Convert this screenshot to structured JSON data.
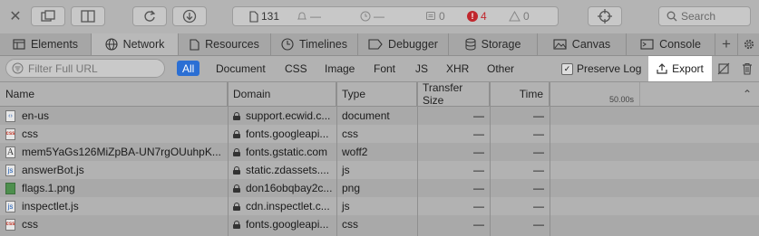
{
  "toolbar": {
    "resource_count": "131",
    "warnings_count_a": "—",
    "timer_value": "—",
    "logs_count": "0",
    "errors_count": "4",
    "issues_count": "0",
    "search_label": "Search"
  },
  "tabs": [
    "Elements",
    "Network",
    "Resources",
    "Timelines",
    "Debugger",
    "Storage",
    "Canvas",
    "Console"
  ],
  "filter": {
    "placeholder": "Filter Full URL",
    "types": [
      "All",
      "Document",
      "CSS",
      "Image",
      "Font",
      "JS",
      "XHR",
      "Other"
    ],
    "preserve_log": "Preserve Log",
    "export": "Export"
  },
  "table": {
    "columns": [
      "Name",
      "Domain",
      "Type",
      "Transfer Size",
      "Time"
    ],
    "timeline_marker": "50.00s",
    "rows": [
      {
        "name": "en-us",
        "domain": "support.ecwid.c...",
        "type": "document",
        "size": "—",
        "time": "—",
        "icon": "doc"
      },
      {
        "name": "css",
        "domain": "fonts.googleapi...",
        "type": "css",
        "size": "—",
        "time": "—",
        "icon": "css"
      },
      {
        "name": "mem5YaGs126MiZpBA-UN7rgOUuhpK...",
        "domain": "fonts.gstatic.com",
        "type": "woff2",
        "size": "—",
        "time": "—",
        "icon": "font"
      },
      {
        "name": "answerBot.js",
        "domain": "static.zdassets....",
        "type": "js",
        "size": "—",
        "time": "—",
        "icon": "js"
      },
      {
        "name": "flags.1.png",
        "domain": "don16obqbay2c...",
        "type": "png",
        "size": "—",
        "time": "—",
        "icon": "img"
      },
      {
        "name": "inspectlet.js",
        "domain": "cdn.inspectlet.c...",
        "type": "js",
        "size": "—",
        "time": "—",
        "icon": "js"
      },
      {
        "name": "css",
        "domain": "fonts.googleapi...",
        "type": "css",
        "size": "—",
        "time": "—",
        "icon": "css"
      }
    ]
  }
}
